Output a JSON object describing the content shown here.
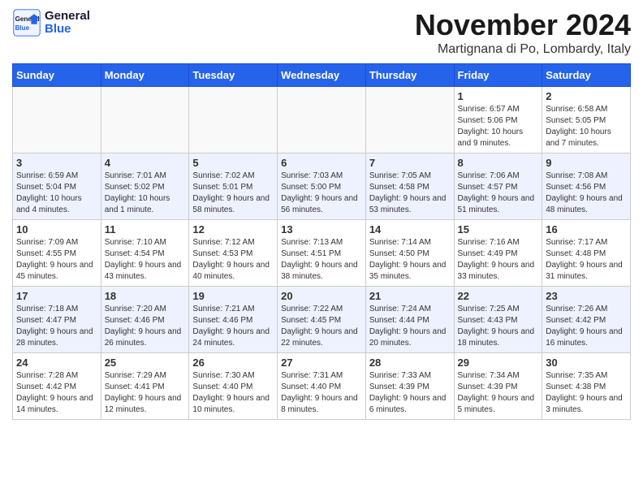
{
  "header": {
    "logo_line1": "General",
    "logo_line2": "Blue",
    "month_year": "November 2024",
    "location": "Martignana di Po, Lombardy, Italy"
  },
  "days_of_week": [
    "Sunday",
    "Monday",
    "Tuesday",
    "Wednesday",
    "Thursday",
    "Friday",
    "Saturday"
  ],
  "weeks": [
    [
      {
        "day": "",
        "info": ""
      },
      {
        "day": "",
        "info": ""
      },
      {
        "day": "",
        "info": ""
      },
      {
        "day": "",
        "info": ""
      },
      {
        "day": "",
        "info": ""
      },
      {
        "day": "1",
        "info": "Sunrise: 6:57 AM\nSunset: 5:06 PM\nDaylight: 10 hours and 9 minutes."
      },
      {
        "day": "2",
        "info": "Sunrise: 6:58 AM\nSunset: 5:05 PM\nDaylight: 10 hours and 7 minutes."
      }
    ],
    [
      {
        "day": "3",
        "info": "Sunrise: 6:59 AM\nSunset: 5:04 PM\nDaylight: 10 hours and 4 minutes."
      },
      {
        "day": "4",
        "info": "Sunrise: 7:01 AM\nSunset: 5:02 PM\nDaylight: 10 hours and 1 minute."
      },
      {
        "day": "5",
        "info": "Sunrise: 7:02 AM\nSunset: 5:01 PM\nDaylight: 9 hours and 58 minutes."
      },
      {
        "day": "6",
        "info": "Sunrise: 7:03 AM\nSunset: 5:00 PM\nDaylight: 9 hours and 56 minutes."
      },
      {
        "day": "7",
        "info": "Sunrise: 7:05 AM\nSunset: 4:58 PM\nDaylight: 9 hours and 53 minutes."
      },
      {
        "day": "8",
        "info": "Sunrise: 7:06 AM\nSunset: 4:57 PM\nDaylight: 9 hours and 51 minutes."
      },
      {
        "day": "9",
        "info": "Sunrise: 7:08 AM\nSunset: 4:56 PM\nDaylight: 9 hours and 48 minutes."
      }
    ],
    [
      {
        "day": "10",
        "info": "Sunrise: 7:09 AM\nSunset: 4:55 PM\nDaylight: 9 hours and 45 minutes."
      },
      {
        "day": "11",
        "info": "Sunrise: 7:10 AM\nSunset: 4:54 PM\nDaylight: 9 hours and 43 minutes."
      },
      {
        "day": "12",
        "info": "Sunrise: 7:12 AM\nSunset: 4:53 PM\nDaylight: 9 hours and 40 minutes."
      },
      {
        "day": "13",
        "info": "Sunrise: 7:13 AM\nSunset: 4:51 PM\nDaylight: 9 hours and 38 minutes."
      },
      {
        "day": "14",
        "info": "Sunrise: 7:14 AM\nSunset: 4:50 PM\nDaylight: 9 hours and 35 minutes."
      },
      {
        "day": "15",
        "info": "Sunrise: 7:16 AM\nSunset: 4:49 PM\nDaylight: 9 hours and 33 minutes."
      },
      {
        "day": "16",
        "info": "Sunrise: 7:17 AM\nSunset: 4:48 PM\nDaylight: 9 hours and 31 minutes."
      }
    ],
    [
      {
        "day": "17",
        "info": "Sunrise: 7:18 AM\nSunset: 4:47 PM\nDaylight: 9 hours and 28 minutes."
      },
      {
        "day": "18",
        "info": "Sunrise: 7:20 AM\nSunset: 4:46 PM\nDaylight: 9 hours and 26 minutes."
      },
      {
        "day": "19",
        "info": "Sunrise: 7:21 AM\nSunset: 4:46 PM\nDaylight: 9 hours and 24 minutes."
      },
      {
        "day": "20",
        "info": "Sunrise: 7:22 AM\nSunset: 4:45 PM\nDaylight: 9 hours and 22 minutes."
      },
      {
        "day": "21",
        "info": "Sunrise: 7:24 AM\nSunset: 4:44 PM\nDaylight: 9 hours and 20 minutes."
      },
      {
        "day": "22",
        "info": "Sunrise: 7:25 AM\nSunset: 4:43 PM\nDaylight: 9 hours and 18 minutes."
      },
      {
        "day": "23",
        "info": "Sunrise: 7:26 AM\nSunset: 4:42 PM\nDaylight: 9 hours and 16 minutes."
      }
    ],
    [
      {
        "day": "24",
        "info": "Sunrise: 7:28 AM\nSunset: 4:42 PM\nDaylight: 9 hours and 14 minutes."
      },
      {
        "day": "25",
        "info": "Sunrise: 7:29 AM\nSunset: 4:41 PM\nDaylight: 9 hours and 12 minutes."
      },
      {
        "day": "26",
        "info": "Sunrise: 7:30 AM\nSunset: 4:40 PM\nDaylight: 9 hours and 10 minutes."
      },
      {
        "day": "27",
        "info": "Sunrise: 7:31 AM\nSunset: 4:40 PM\nDaylight: 9 hours and 8 minutes."
      },
      {
        "day": "28",
        "info": "Sunrise: 7:33 AM\nSunset: 4:39 PM\nDaylight: 9 hours and 6 minutes."
      },
      {
        "day": "29",
        "info": "Sunrise: 7:34 AM\nSunset: 4:39 PM\nDaylight: 9 hours and 5 minutes."
      },
      {
        "day": "30",
        "info": "Sunrise: 7:35 AM\nSunset: 4:38 PM\nDaylight: 9 hours and 3 minutes."
      }
    ]
  ]
}
